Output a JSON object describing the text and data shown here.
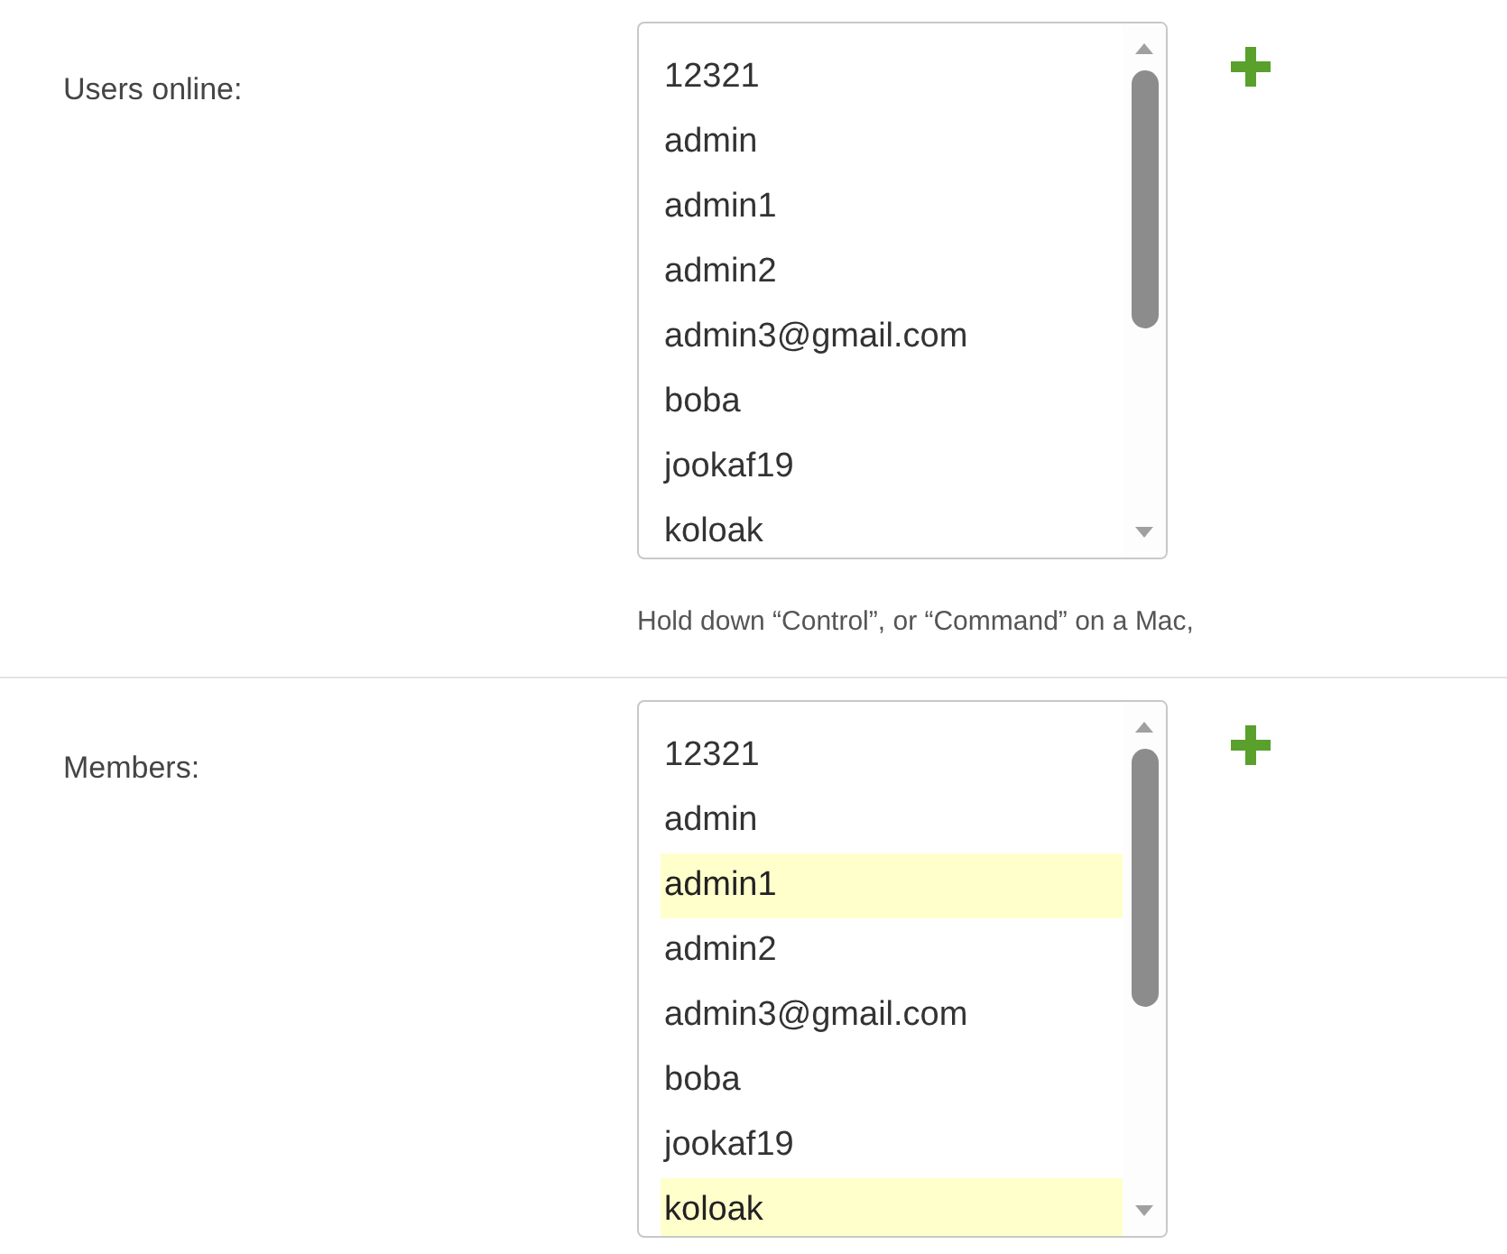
{
  "sections": [
    {
      "label": "Users online:",
      "items": [
        {
          "text": "12321",
          "selected": false
        },
        {
          "text": "admin",
          "selected": false
        },
        {
          "text": "admin1",
          "selected": false
        },
        {
          "text": "admin2",
          "selected": false
        },
        {
          "text": "admin3@gmail.com",
          "selected": false
        },
        {
          "text": "boba",
          "selected": false
        },
        {
          "text": "jookaf19",
          "selected": false
        },
        {
          "text": "koloak",
          "selected": false
        }
      ],
      "help": "Hold down “Control”, or “Command” on a Mac,"
    },
    {
      "label": "Members:",
      "items": [
        {
          "text": "12321",
          "selected": false
        },
        {
          "text": "admin",
          "selected": false
        },
        {
          "text": "admin1",
          "selected": true
        },
        {
          "text": "admin2",
          "selected": false
        },
        {
          "text": "admin3@gmail.com",
          "selected": false
        },
        {
          "text": "boba",
          "selected": false
        },
        {
          "text": "jookaf19",
          "selected": false
        },
        {
          "text": "koloak",
          "selected": true
        }
      ]
    }
  ]
}
